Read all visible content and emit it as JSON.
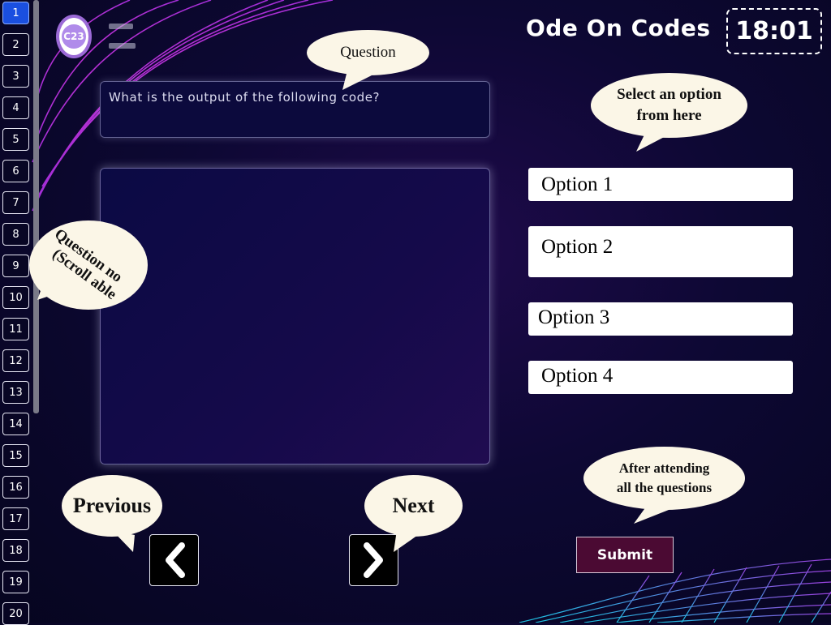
{
  "header": {
    "app_title": "Ode On Codes",
    "timer": "18:01",
    "logo_text": "C23",
    "user_name": "",
    "user_id": ""
  },
  "question_nav": {
    "items": [
      "1",
      "2",
      "3",
      "4",
      "5",
      "6",
      "7",
      "8",
      "9",
      "10",
      "11",
      "12",
      "13",
      "14",
      "15",
      "16",
      "17",
      "18",
      "19",
      "20"
    ],
    "active": "1"
  },
  "question": {
    "text": "What is the output of the following code?",
    "code": ""
  },
  "options": [
    "Option 1",
    "Option 2",
    "Option 3",
    "Option 4"
  ],
  "buttons": {
    "prev_icon": "chevron-left-icon",
    "next_icon": "chevron-right-icon",
    "submit": "Submit"
  },
  "bubbles": {
    "question": "Question",
    "select_line1": "Select an option",
    "select_line2": "from here",
    "qno_line1": "Question no",
    "qno_line2": "(Scroll able",
    "previous": "Previous",
    "next": "Next",
    "after_line1": "After attending",
    "after_line2": "all the questions"
  },
  "colors": {
    "background": "#0d0833",
    "active_question": "#1a4fe0",
    "submit_bg": "#4b0a33",
    "bubble_bg": "#fbf6e7"
  }
}
